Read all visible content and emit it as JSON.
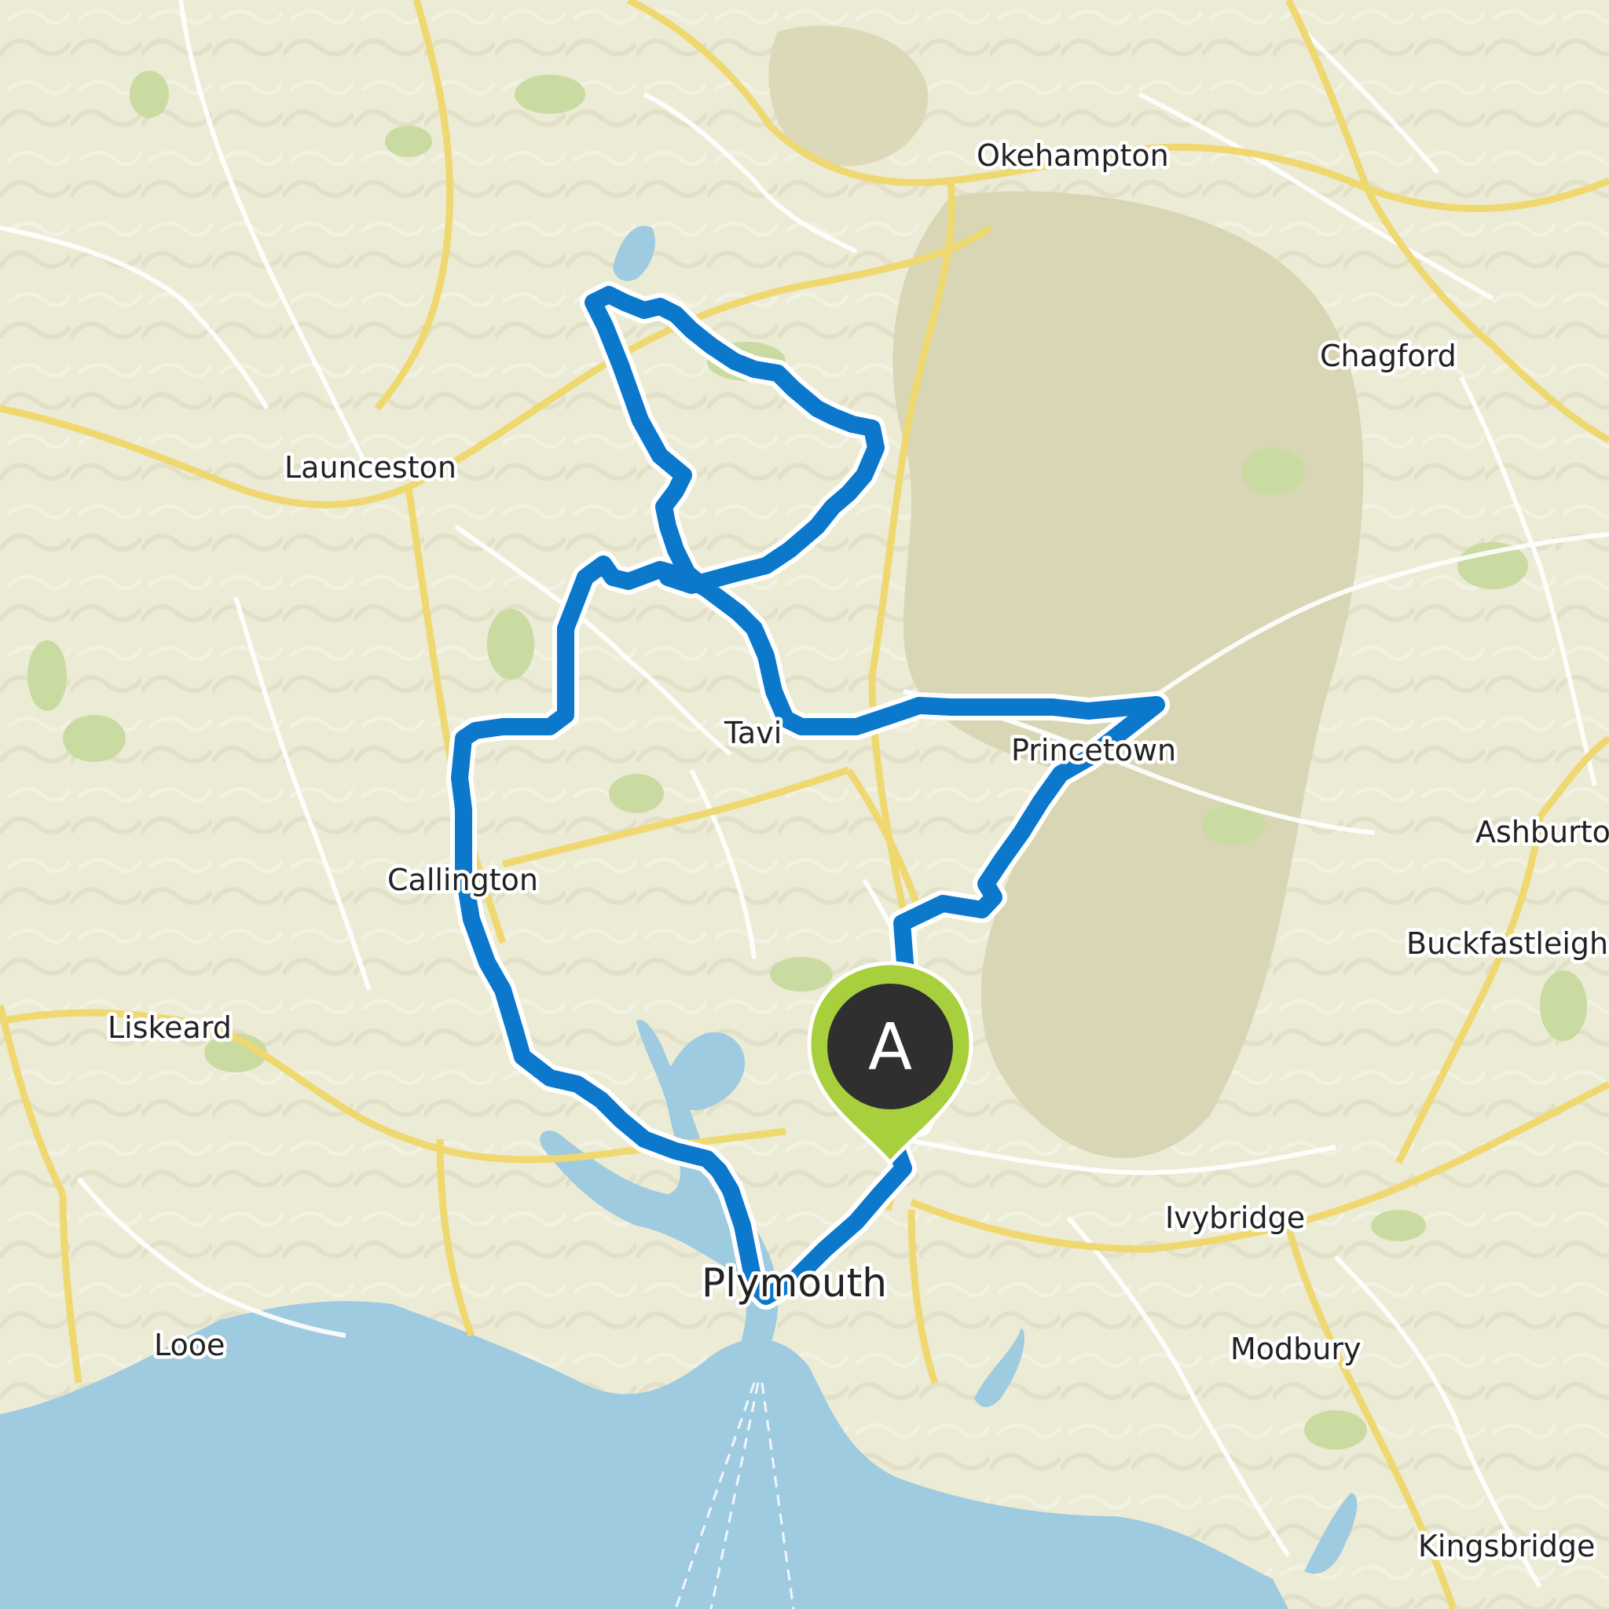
{
  "map": {
    "marker": {
      "letter": "A",
      "pin_color": "#a8cf3c",
      "badge_color": "#2f2f2f"
    },
    "route": {
      "color": "#0b78cc"
    },
    "colors": {
      "sea": "#9fcbe0",
      "land": "#ecebd6",
      "moor": "#d8d6b4",
      "woods": "#c9dba1",
      "major_road": "#f0d870"
    },
    "places": {
      "okehampton": "Okehampton",
      "chagford": "Chagford",
      "launceston": "Launceston",
      "tavistock": "Tavi",
      "princetown": "Princetown",
      "callington": "Callington",
      "ashburton": "Ashburton",
      "buckfastleigh": "Buckfastleigh",
      "liskeard": "Liskeard",
      "ivybridge": "Ivybridge",
      "plymouth": "Plymouth",
      "modbury": "Modbury",
      "looe": "Looe",
      "kingsbridge": "Kingsbridge"
    }
  }
}
